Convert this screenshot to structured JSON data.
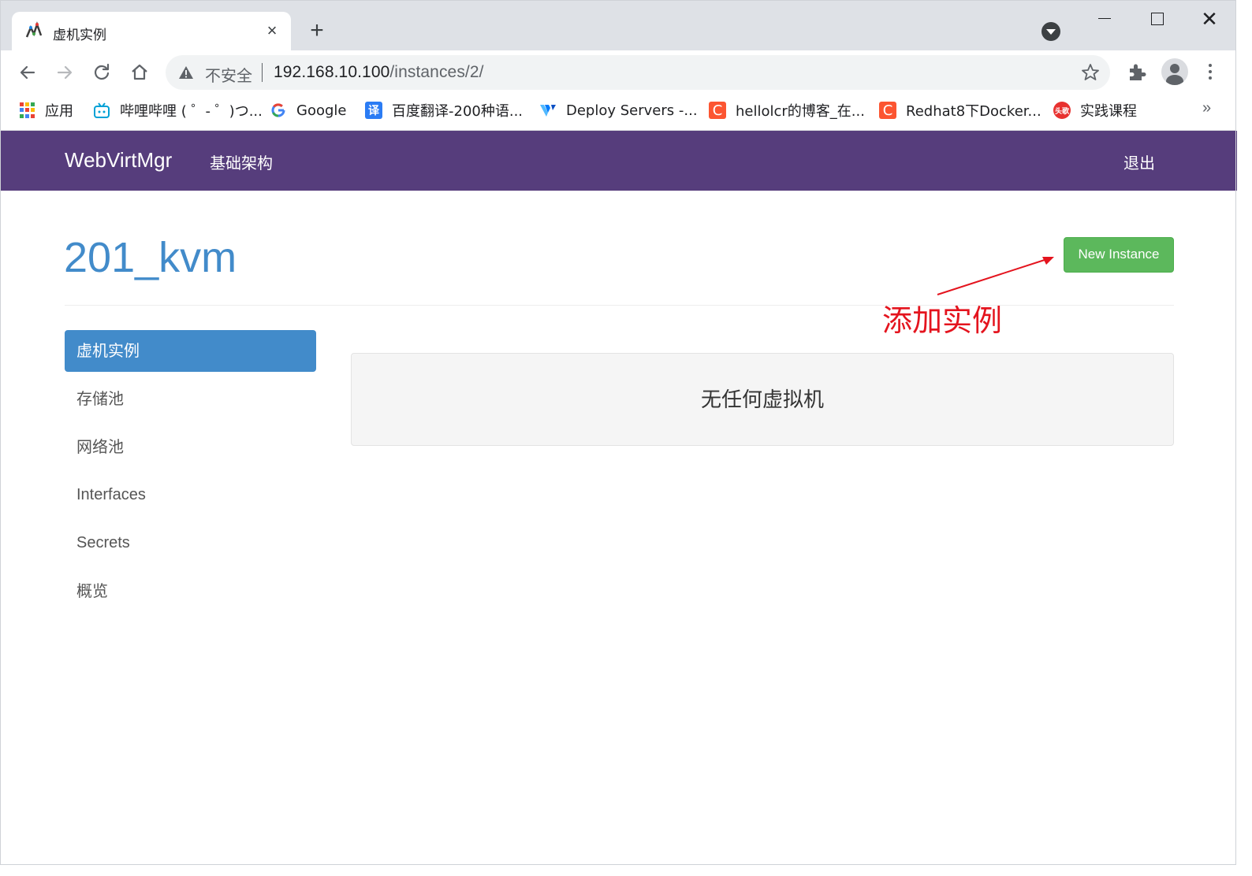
{
  "browser": {
    "tab": {
      "title": "虚机实例",
      "close": "×"
    },
    "new_tab": "+",
    "window": {
      "close": "✕"
    },
    "omnibox": {
      "security_label": "不安全",
      "url_host": "192.168.10.100",
      "url_path": "/instances/2/"
    },
    "bookmarks": [
      {
        "label": "应用",
        "icon": "apps-grid-icon"
      },
      {
        "label": "哔哩哔哩 ( ゜- ゜)つ...",
        "icon": "bilibili-icon",
        "color": "#00a1d6"
      },
      {
        "label": "Google",
        "icon": "google-icon"
      },
      {
        "label": "百度翻译-200种语...",
        "icon": "baidu-translate-icon",
        "color": "#2b7cf4"
      },
      {
        "label": "Deploy Servers -...",
        "icon": "vultr-icon",
        "color": "#007bfc"
      },
      {
        "label": "hellolcr的博客_在...",
        "icon": "csdn-icon",
        "color": "#fc5531"
      },
      {
        "label": "Redhat8下Docker...",
        "icon": "csdn-icon",
        "color": "#fc5531"
      },
      {
        "label": "实践课程",
        "icon": "toutiao-icon",
        "color": "#e8312f"
      }
    ],
    "bookmarks_overflow": "»"
  },
  "navbar": {
    "brand": "WebVirtMgr",
    "link": "基础架构",
    "logout": "退出",
    "color": "#563d7c"
  },
  "main": {
    "host_title": "201_kvm",
    "new_instance_button": "New Instance",
    "annotation": "添加实例",
    "sidebar": [
      {
        "label": "虚机实例",
        "active": true
      },
      {
        "label": "存储池",
        "active": false
      },
      {
        "label": "网络池",
        "active": false
      },
      {
        "label": "Interfaces",
        "active": false
      },
      {
        "label": "Secrets",
        "active": false
      },
      {
        "label": "概览",
        "active": false
      }
    ],
    "empty_message": "无任何虚拟机"
  },
  "colors": {
    "primary": "#428bca",
    "success": "#5cb85c",
    "annotation": "#e4141e"
  }
}
